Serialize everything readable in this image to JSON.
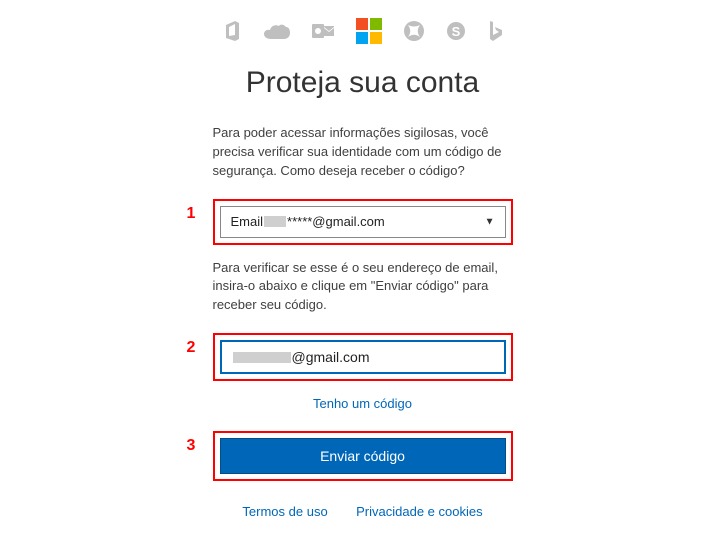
{
  "icons": [
    "office",
    "onedrive",
    "outlook",
    "microsoft-logo",
    "xbox",
    "skype",
    "bing"
  ],
  "title": "Proteja sua conta",
  "intro": "Para poder acessar informações sigilosas, você precisa verificar sua identidade com um código de segurança. Como deseja receber o código?",
  "verify_method": {
    "prefix": "Email ",
    "masked": "*****@gmail.com"
  },
  "instruction": "Para verificar se esse é o seu endereço de email, insira-o abaixo e clique em \"Enviar código\" para receber seu código.",
  "email_input": {
    "suffix": "@gmail.com"
  },
  "have_code_link": "Tenho um código",
  "submit_label": "Enviar código",
  "footer": {
    "terms": "Termos de uso",
    "privacy": "Privacidade e cookies"
  },
  "annotations": {
    "a1": "1",
    "a2": "2",
    "a3": "3"
  }
}
